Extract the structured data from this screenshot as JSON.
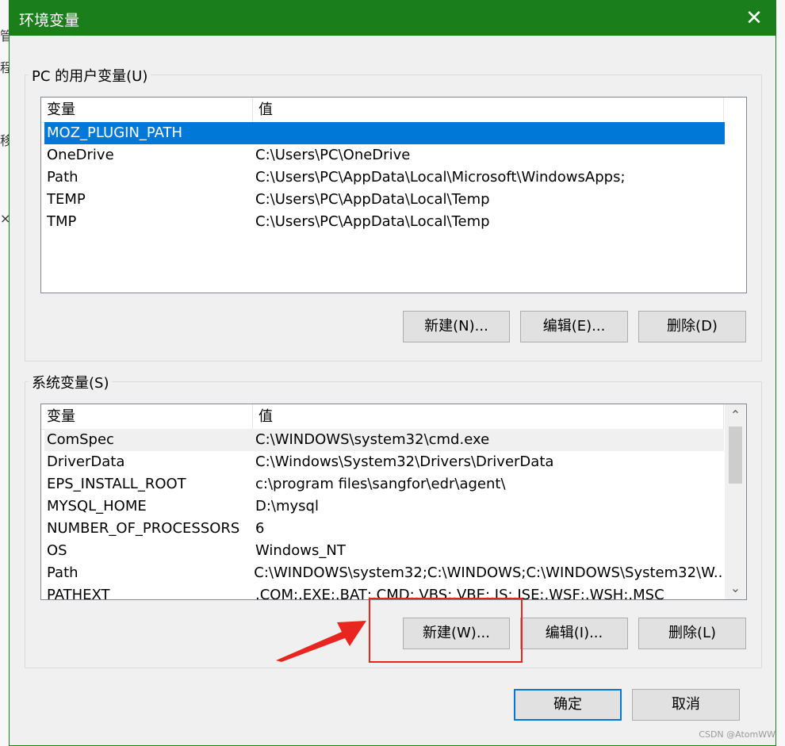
{
  "dialog": {
    "title": "环境变量",
    "close_glyph": "✕"
  },
  "background": {
    "left_glyphs": [
      "管",
      "程",
      "移",
      "×"
    ]
  },
  "user_vars": {
    "legend": "PC 的用户变量(U)",
    "columns": [
      "变量",
      "值"
    ],
    "rows": [
      {
        "name": "MOZ_PLUGIN_PATH",
        "value": "",
        "selected": true
      },
      {
        "name": "OneDrive",
        "value": "C:\\Users\\PC\\OneDrive"
      },
      {
        "name": "Path",
        "value": "C:\\Users\\PC\\AppData\\Local\\Microsoft\\WindowsApps;"
      },
      {
        "name": "TEMP",
        "value": "C:\\Users\\PC\\AppData\\Local\\Temp"
      },
      {
        "name": "TMP",
        "value": "C:\\Users\\PC\\AppData\\Local\\Temp"
      }
    ],
    "buttons": {
      "new": "新建(N)...",
      "edit": "编辑(E)...",
      "delete": "删除(D)"
    }
  },
  "system_vars": {
    "legend": "系统变量(S)",
    "columns": [
      "变量",
      "值"
    ],
    "rows": [
      {
        "name": "ComSpec",
        "value": "C:\\WINDOWS\\system32\\cmd.exe",
        "hot": true
      },
      {
        "name": "DriverData",
        "value": "C:\\Windows\\System32\\Drivers\\DriverData"
      },
      {
        "name": "EPS_INSTALL_ROOT",
        "value": "c:\\program files\\sangfor\\edr\\agent\\"
      },
      {
        "name": "MYSQL_HOME",
        "value": "D:\\mysql"
      },
      {
        "name": "NUMBER_OF_PROCESSORS",
        "value": "6"
      },
      {
        "name": "OS",
        "value": "Windows_NT"
      },
      {
        "name": "Path",
        "value": "C:\\WINDOWS\\system32;C:\\WINDOWS;C:\\WINDOWS\\System32\\W..."
      },
      {
        "name": "PATHEXT",
        "value": ".COM;.EXE;.BAT;.CMD;.VBS;.VBE;.JS;.JSE;.WSF;.WSH;.MSC"
      }
    ],
    "buttons": {
      "new": "新建(W)...",
      "edit": "编辑(I)...",
      "delete": "删除(L)"
    },
    "scroll_up_icon": "⌃",
    "scroll_down_icon": "⌄"
  },
  "footer": {
    "ok": "确定",
    "cancel": "取消"
  },
  "annotation": {
    "color": "#e8261f"
  },
  "watermark": "CSDN @AtomWW",
  "colors": {
    "titlebar": "#1a7f1a",
    "selection": "#0078d7"
  }
}
